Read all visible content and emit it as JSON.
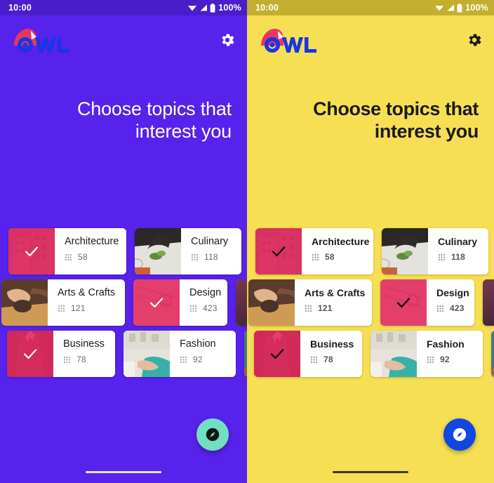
{
  "panels": [
    {
      "theme": "light",
      "status": {
        "clock": "10:00",
        "battery": "100%",
        "wifi_icon": "wifi-icon",
        "signal_icon": "signal-icon",
        "battery_icon": "battery-icon"
      },
      "appbar": {
        "logo_text": "OWL",
        "logo_icon": "owl-logo-icon",
        "settings_icon": "gear-icon"
      },
      "headline": "Choose topics that interest you",
      "fab": {
        "icon": "explore-compass-icon"
      }
    },
    {
      "theme": "yellow",
      "status": {
        "clock": "10:00",
        "battery": "100%",
        "wifi_icon": "wifi-icon",
        "signal_icon": "signal-icon",
        "battery_icon": "battery-icon"
      },
      "appbar": {
        "logo_text": "OWL",
        "logo_icon": "owl-logo-icon",
        "settings_icon": "gear-icon"
      },
      "headline": "Choose topics that interest you",
      "fab": {
        "icon": "explore-compass-icon"
      }
    }
  ],
  "topics": {
    "count_icon": "grain-grid-icon",
    "rows": [
      [
        {
          "name": "Architecture",
          "count": "58",
          "selected": true,
          "art": "architecture"
        },
        {
          "name": "Culinary",
          "count": "118",
          "selected": false,
          "art": "culinary"
        },
        {
          "name": "",
          "count": "",
          "selected": false,
          "art": "edge-a",
          "edge": true
        }
      ],
      [
        {
          "name": "Arts & Crafts",
          "count": "121",
          "selected": false,
          "art": "arts"
        },
        {
          "name": "Design",
          "count": "423",
          "selected": true,
          "art": "design"
        },
        {
          "name": "",
          "count": "",
          "selected": false,
          "art": "edge-b",
          "edge": true
        }
      ],
      [
        {
          "name": "Business",
          "count": "78",
          "selected": true,
          "art": "business"
        },
        {
          "name": "Fashion",
          "count": "92",
          "selected": false,
          "art": "fashion"
        },
        {
          "name": "",
          "count": "",
          "selected": false,
          "art": "edge-c",
          "edge": true
        }
      ]
    ]
  },
  "colors": {
    "purple_bg": "#5722EC",
    "purple_statusbar": "#4A1DCB",
    "yellow_bg": "#F7DF54",
    "yellow_statusbar": "#C4AE2F",
    "accent_pink": "#E8265F",
    "logo_blue": "#1835E8",
    "logo_crimson": "#E8365F",
    "fab_teal": "#72DEC2",
    "fab_blue": "#1146E0",
    "text_dark": "#1C1B1A"
  }
}
